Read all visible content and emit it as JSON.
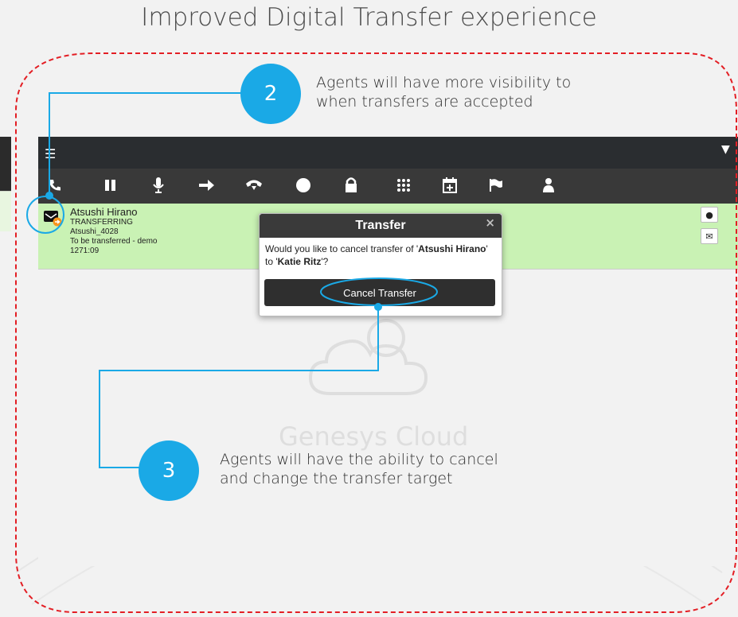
{
  "slide": {
    "title": "Improved Digital Transfer experience"
  },
  "callouts": [
    {
      "number": "2",
      "text_line1": "Agents will have more visibility to",
      "text_line2": "when transfers are accepted"
    },
    {
      "number": "3",
      "text_line1": "Agents will have the ability to cancel",
      "text_line2": "and change the transfer target"
    }
  ],
  "app": {
    "menu_icon": "hamburger-menu-icon",
    "toolbar_icons": [
      "phone-icon",
      "pause-icon",
      "microphone-icon",
      "transfer-arrow-icon",
      "hold-icon",
      "record-icon",
      "lock-icon",
      "dialpad-icon",
      "schedule-icon",
      "flag-icon",
      "person-icon"
    ],
    "watermark": "Genesys Cloud"
  },
  "interaction": {
    "name": "Atsushi Hirano",
    "state": "TRANSFERRING",
    "address": "Atsushi_4028",
    "queue": "To be transferred - demo",
    "timer": "1271:09"
  },
  "modal": {
    "title": "Transfer",
    "close": "×",
    "message_prefix": "Would you like to cancel transfer of '",
    "message_name1": "Atsushi Hirano",
    "message_mid": "' to '",
    "message_name2": "Katie Ritz",
    "message_suffix": "'?",
    "button_label": "Cancel Transfer"
  },
  "colors": {
    "accent": "#1aa9e6",
    "dash_border": "#e31e24",
    "interaction_bg": "#c9f2b4",
    "toolbar_bg": "#393939"
  }
}
